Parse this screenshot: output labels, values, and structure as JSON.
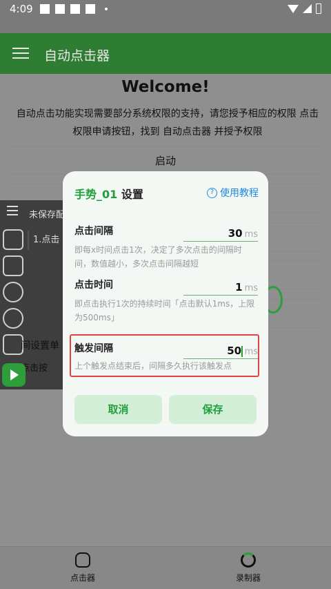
{
  "status": {
    "time": "4:09"
  },
  "app": {
    "title": "自动点击器"
  },
  "main": {
    "welcome": "Welcome!",
    "description": "自动点击功能实现需要部分系统权限的支持，请您授予相应的权限 点击权限申请按钮，找到 自动点击器 并授予权限",
    "start_button": "启动"
  },
  "floating": {
    "title": "未保存配",
    "list_item": "1.点击",
    "text_1": "间设置单",
    "text_2": "点击按"
  },
  "dialog": {
    "title_name": "手势_01",
    "title_suffix": "设置",
    "help_label": "使用教程",
    "fields": [
      {
        "label": "点击间隔",
        "value": "30",
        "unit": "ms",
        "hint": "即每x时间点击1次，决定了多次点击的间隔时间，数值越小，多次点击间隔越短"
      },
      {
        "label": "点击时间",
        "value": "1",
        "unit": "ms",
        "hint": "即点击执行1次的持续时间「点击默认1ms，上限为500ms」"
      },
      {
        "label": "触发间隔",
        "value": "50",
        "unit": "ms",
        "hint": "上个触发点结束后，间隔多久执行该触发点"
      }
    ],
    "cancel": "取消",
    "save": "保存"
  },
  "bottom_nav": [
    {
      "label": "点击器",
      "icon": "hand-tap-icon"
    },
    {
      "label": "录制器",
      "icon": "record-icon"
    }
  ],
  "colors": {
    "primary": "#2f7d32",
    "accent": "#1fa03a",
    "link": "#1e88e5",
    "highlight": "#e24444"
  }
}
